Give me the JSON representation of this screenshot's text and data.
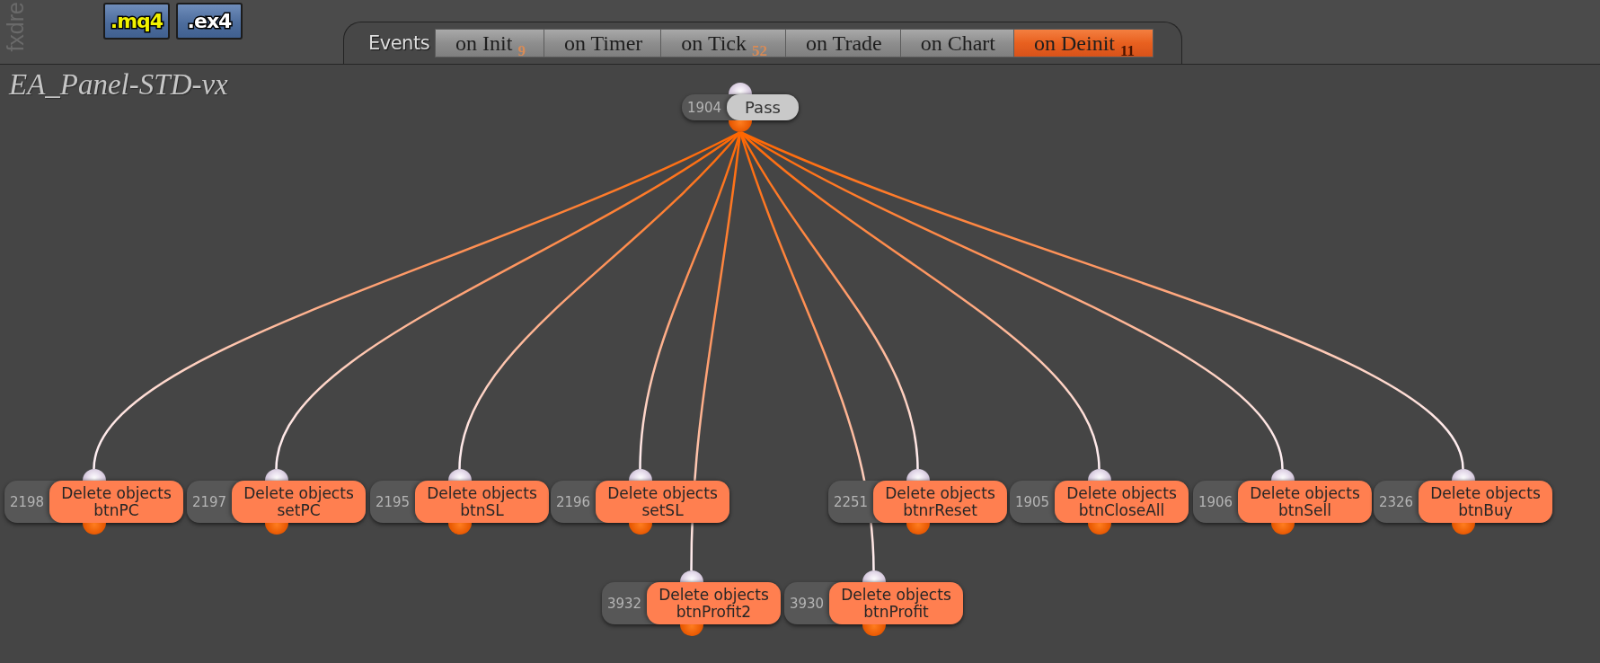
{
  "logo_text": "fxdre",
  "file_buttons": [
    {
      "label": ".mq4",
      "color": "#f2f200"
    },
    {
      "label": ".ex4",
      "color": "#ffffff"
    }
  ],
  "events": {
    "label": "Events",
    "tabs": [
      {
        "label": "on Init",
        "count": "9",
        "selected": false
      },
      {
        "label": "on Timer",
        "selected": false
      },
      {
        "label": "on Tick",
        "count": "52",
        "selected": false
      },
      {
        "label": "on Trade",
        "selected": false
      },
      {
        "label": "on Chart",
        "selected": false
      },
      {
        "label": "on Deinit",
        "count": "11",
        "selected": true
      }
    ]
  },
  "title": "EA_Panel-STD-vx",
  "graph": {
    "root": {
      "id": "1904",
      "label": "Pass",
      "children": [
        {
          "id": "2198",
          "action": "Delete objects",
          "target": "btnPC"
        },
        {
          "id": "2197",
          "action": "Delete objects",
          "target": "setPC"
        },
        {
          "id": "2195",
          "action": "Delete objects",
          "target": "btnSL"
        },
        {
          "id": "2196",
          "action": "Delete objects",
          "target": "setSL"
        },
        {
          "id": "2251",
          "action": "Delete objects",
          "target": "btnrReset"
        },
        {
          "id": "1905",
          "action": "Delete objects",
          "target": "btnCloseAll"
        },
        {
          "id": "1906",
          "action": "Delete objects",
          "target": "btnSell"
        },
        {
          "id": "2326",
          "action": "Delete objects",
          "target": "btnBuy"
        },
        {
          "id": "3932",
          "action": "Delete objects",
          "target": "btnProfit2"
        },
        {
          "id": "3930",
          "action": "Delete objects",
          "target": "btnProfit"
        }
      ]
    }
  }
}
